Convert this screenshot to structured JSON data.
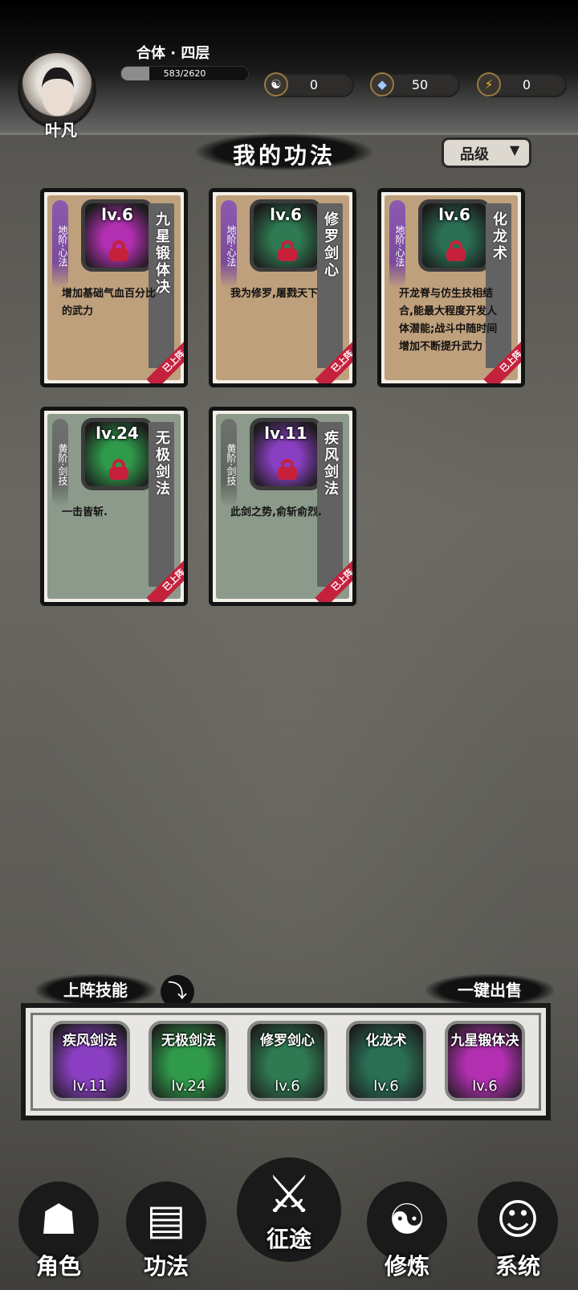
{
  "player": {
    "name": "叶凡",
    "realm": "合体 · 四层",
    "exp_text": "583/2620",
    "exp_progress": 0.2225
  },
  "resources": [
    {
      "icon": "yin-yang-icon",
      "value": "0"
    },
    {
      "icon": "crystal-icon",
      "value": "50"
    },
    {
      "icon": "lightning-icon",
      "value": "0"
    }
  ],
  "page_title": "我的功法",
  "sort_button": {
    "label": "品级",
    "arrow": "▼"
  },
  "cards": [
    {
      "grade": "地阶·心法",
      "level": "lv.6",
      "name": "九星锻体决",
      "desc": "增加基础气血百分比的武力",
      "status": "已上阵",
      "theme": "tan",
      "art": "#b22fb1"
    },
    {
      "grade": "地阶·心法",
      "level": "lv.6",
      "name": "修罗剑心",
      "desc": "我为修罗,屠戮天下",
      "status": "已上阵",
      "theme": "tan",
      "art": "#2f7a52"
    },
    {
      "grade": "地阶·心法",
      "level": "lv.6",
      "name": "化龙术",
      "desc": "开龙脊与仿生技相结合,能最大程度开发人体潜能;战斗中随时间增加不断提升武力",
      "status": "已上阵",
      "theme": "tan",
      "art": "#2a6f55"
    },
    {
      "grade": "黄阶·剑技",
      "level": "lv.24",
      "name": "无极剑法",
      "desc": "一击皆斩.",
      "status": "已上阵",
      "theme": "green",
      "art": "#2f9a4a"
    },
    {
      "grade": "黄阶·剑技",
      "level": "lv.11",
      "name": "疾风剑法",
      "desc": "此剑之势,俞斩俞烈.",
      "status": "已上阵",
      "theme": "green",
      "art": "#8a3fc2"
    }
  ],
  "equipped_label": "上阵技能",
  "toggle_icon": "⤵",
  "sell_all_label": "一键出售",
  "equipped": [
    {
      "name": "疾风剑法",
      "level": "lv.11",
      "art": "#8a3fc2"
    },
    {
      "name": "无极剑法",
      "level": "lv.24",
      "art": "#2f9a4a"
    },
    {
      "name": "修罗剑心",
      "level": "lv.6",
      "art": "#2f7a52"
    },
    {
      "name": "化龙术",
      "level": "lv.6",
      "art": "#2a6f55"
    },
    {
      "name": "九星锻体决",
      "level": "lv.6",
      "art": "#b22fb1"
    }
  ],
  "nav": [
    {
      "label": "角色",
      "icon": "hooded-figure-icon",
      "glyph": "☗"
    },
    {
      "label": "功法",
      "icon": "books-icon",
      "glyph": "▤"
    },
    {
      "label": "征途",
      "icon": "sword-emblem-icon",
      "glyph": "⚔"
    },
    {
      "label": "修炼",
      "icon": "meditation-icon",
      "glyph": "☯"
    },
    {
      "label": "系统",
      "icon": "mascot-icon",
      "glyph": "☺"
    }
  ]
}
